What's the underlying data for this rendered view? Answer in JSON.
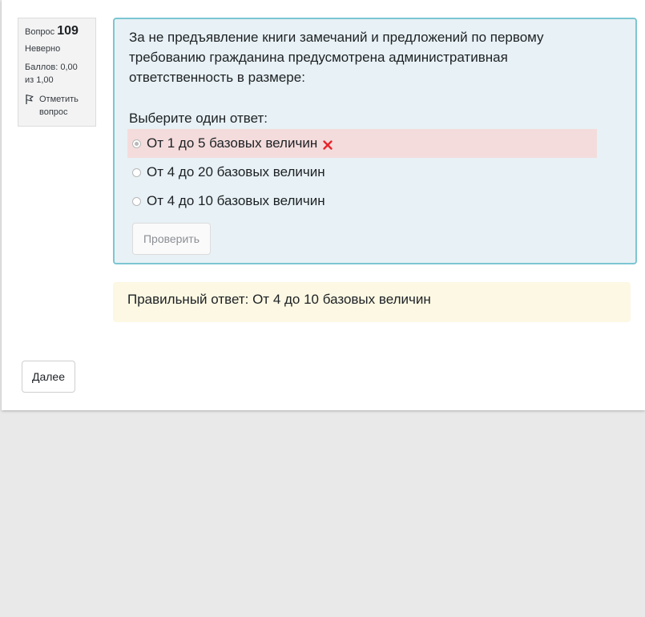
{
  "question_info": {
    "label": "Вопрос",
    "number": "109",
    "state": "Неверно",
    "grade": "Баллов: 0,00 из 1,00",
    "flag_label": "Отметить вопрос",
    "flag_icon": "flag-icon"
  },
  "question": {
    "text": "За не предъявление книги замечаний и предложений по первому требованию гражданина предусмотрена административная ответственность в размере:",
    "prompt": "Выберите один ответ:",
    "answers": [
      {
        "label": "От 1 до 5 базовых величин",
        "selected": true,
        "status": "incorrect",
        "status_icon": "cross-icon"
      },
      {
        "label": "От 4 до 20 базовых величин",
        "selected": false
      },
      {
        "label": "От 4 до 10 базовых величин",
        "selected": false
      }
    ],
    "check_button": "Проверить"
  },
  "feedback": {
    "right_answer": "Правильный ответ: От 4 до 10 базовых величин"
  },
  "navigation": {
    "next_button": "Далее"
  },
  "colors": {
    "formulation_bg": "#e8f1f5",
    "formulation_border": "#7cc6d2",
    "incorrect_bg": "#f4dcdc",
    "feedback_bg": "#fcf8e3",
    "cross": "#e7242b"
  }
}
